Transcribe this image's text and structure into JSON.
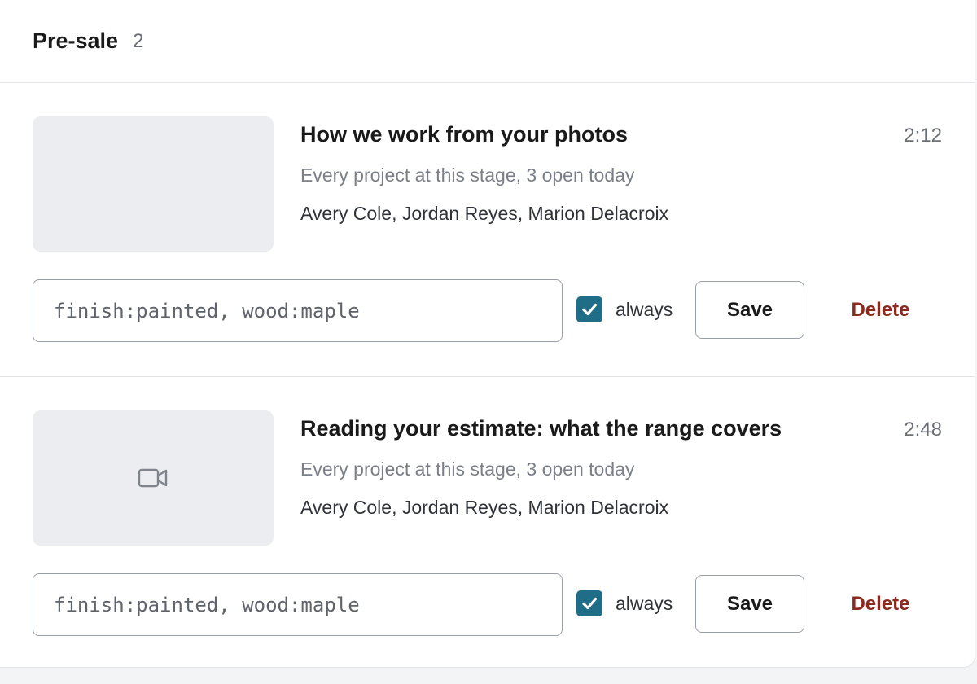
{
  "group": {
    "title": "Pre-sale",
    "count": "2"
  },
  "colors": {
    "accent": "#1f6d86",
    "danger": "#8b2a1f",
    "thumbnail_bg": "#ebedf0"
  },
  "items": [
    {
      "title": "How we work from your photos",
      "duration": "2:12",
      "subtitle": "Every project at this stage, 3 open today",
      "people": "Avery Cole, Jordan Reyes, Marion Delacroix",
      "thumbnail_icon": "",
      "tags_value": "finish:painted, wood:maple",
      "always_checked": true,
      "always_label": "always",
      "save_label": "Save",
      "delete_label": "Delete"
    },
    {
      "title": "Reading your estimate: what the range covers",
      "duration": "2:48",
      "subtitle": "Every project at this stage, 3 open today",
      "people": "Avery Cole, Jordan Reyes, Marion Delacroix",
      "thumbnail_icon": "video-camera-icon",
      "tags_value": "finish:painted, wood:maple",
      "always_checked": true,
      "always_label": "always",
      "save_label": "Save",
      "delete_label": "Delete"
    }
  ]
}
